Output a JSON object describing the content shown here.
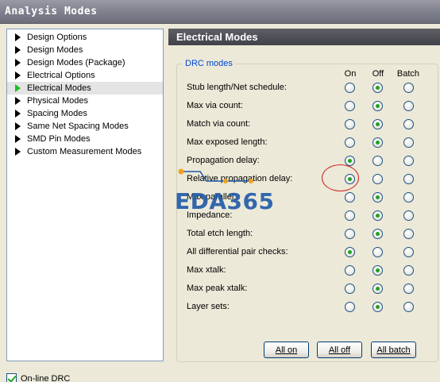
{
  "window": {
    "title": "Analysis Modes"
  },
  "tree": {
    "items": [
      {
        "label": "Design Options",
        "selected": false
      },
      {
        "label": "Design Modes",
        "selected": false
      },
      {
        "label": "Design Modes (Package)",
        "selected": false
      },
      {
        "label": "Electrical Options",
        "selected": false
      },
      {
        "label": "Electrical Modes",
        "selected": true
      },
      {
        "label": "Physical Modes",
        "selected": false
      },
      {
        "label": "Spacing Modes",
        "selected": false
      },
      {
        "label": "Same Net Spacing Modes",
        "selected": false
      },
      {
        "label": "SMD Pin Modes",
        "selected": false
      },
      {
        "label": "Custom Measurement Modes",
        "selected": false
      }
    ]
  },
  "panel": {
    "header": "Electrical Modes",
    "group_title": "DRC modes",
    "columns": {
      "on": "On",
      "off": "Off",
      "batch": "Batch"
    },
    "rows": [
      {
        "label": "Stub length/Net schedule:",
        "value": "off"
      },
      {
        "label": "Max via count:",
        "value": "off"
      },
      {
        "label": "Match via count:",
        "value": "off"
      },
      {
        "label": "Max exposed length:",
        "value": "off"
      },
      {
        "label": "Propagation delay:",
        "value": "on"
      },
      {
        "label": "Relative propagation delay:",
        "value": "on"
      },
      {
        "label": "Max parallel:",
        "value": "off"
      },
      {
        "label": "Impedance:",
        "value": "off"
      },
      {
        "label": "Total etch length:",
        "value": "off"
      },
      {
        "label": "All differential pair checks:",
        "value": "on"
      },
      {
        "label": "Max xtalk:",
        "value": "off"
      },
      {
        "label": "Max peak xtalk:",
        "value": "off"
      },
      {
        "label": "Layer sets:",
        "value": "off"
      }
    ],
    "buttons": {
      "all_on": "All on",
      "all_off": "All off",
      "all_batch": "All batch"
    }
  },
  "footer": {
    "online_drc_label": "On-line DRC",
    "online_drc_checked": true
  },
  "watermark": {
    "text": "EDA365"
  },
  "colors": {
    "accent_green": "#21a121",
    "header_dark": "#414149",
    "group_title": "#0046d5",
    "watermark_blue": "#1e5aa8"
  }
}
